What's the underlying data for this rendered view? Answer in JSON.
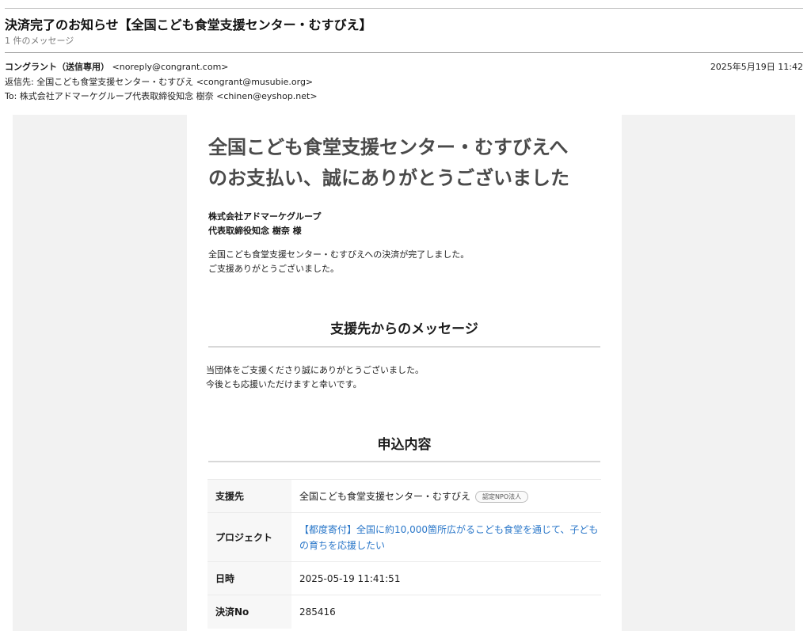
{
  "email": {
    "subject": "決済完了のお知らせ【全国こども食堂支援センター・むすびえ】",
    "message_count": "1 件のメッセージ",
    "from_name": "コングラント（送信専用）",
    "from_address": "<noreply@congrant.com>",
    "reply_to": "返信先: 全国こども食堂支援センター・むすびえ <congrant@musubie.org>",
    "to": "To: 株式会社アドマーケグループ代表取締役知念 樹奈 <chinen@eyshop.net>",
    "date": "2025年5月19日 11:42"
  },
  "body": {
    "title_line1": "全国こども食堂支援センター・むすびえへ",
    "title_line2": "のお支払い、誠にありがとうございました",
    "recipient_company": "株式会社アドマーケグループ",
    "recipient_person": "代表取締役知念 樹奈 様",
    "intro_line1": "全国こども食堂支援センター・むすびえへの決済が完了しました。",
    "intro_line2": "ご支援ありがとうございました。",
    "message_section_title": "支援先からのメッセージ",
    "org_message_line1": "当団体をご支援くださり誠にありがとうございました。",
    "org_message_line2": "今後とも応援いただけますと幸いです。",
    "details_section_title": "申込内容",
    "details": [
      {
        "label": "支援先",
        "value": "全国こども食堂支援センター・むすびえ",
        "badge": "認定NPO法人"
      },
      {
        "label": "プロジェクト",
        "value": "【都度寄付】全国に約10,000箇所広がるこども食堂を通じて、子どもの育ちを応援したい"
      },
      {
        "label": "日時",
        "value": "2025-05-19 11:41:51"
      },
      {
        "label": "決済No",
        "value": "285416"
      }
    ]
  },
  "colors": {
    "link": "#2a77c9",
    "title_grey": "#4a4a4a",
    "panel_bg": "#f2f2f2"
  }
}
